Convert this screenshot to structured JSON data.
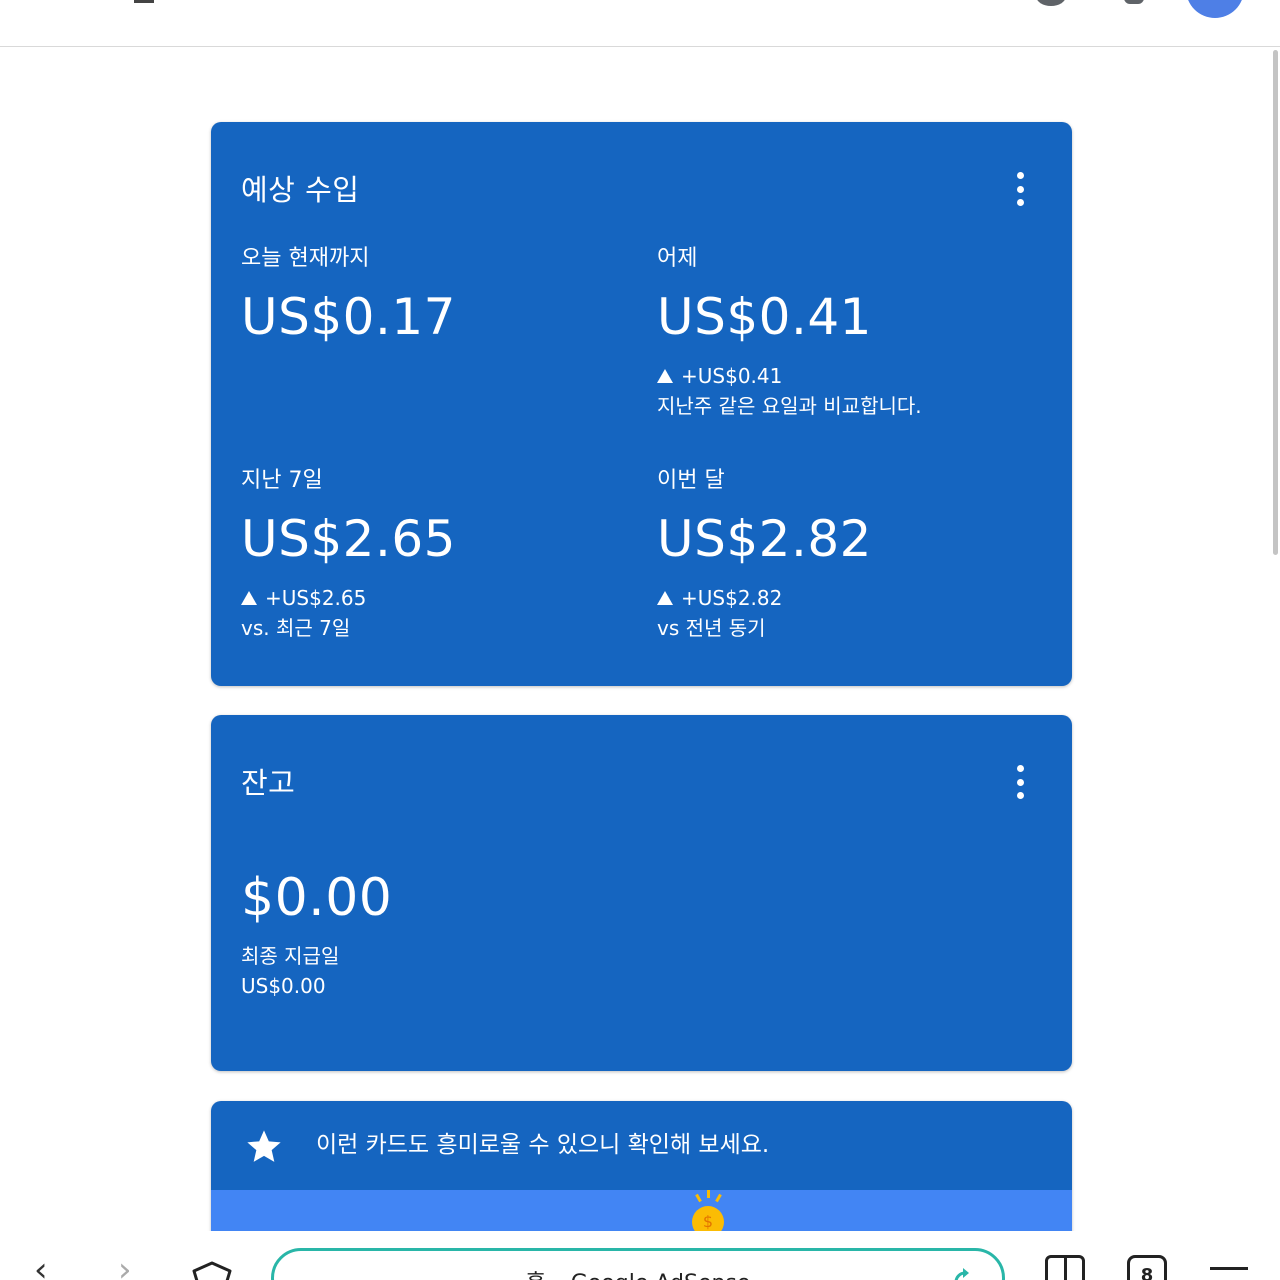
{
  "estimated": {
    "title": "예상 수입",
    "today": {
      "label": "오늘 현재까지",
      "value": "US$0.17"
    },
    "yesterday": {
      "label": "어제",
      "value": "US$0.41",
      "delta": "+US$0.41",
      "compare": "지난주 같은 요일과 비교합니다."
    },
    "last7": {
      "label": "지난 7일",
      "value": "US$2.65",
      "delta": "+US$2.65",
      "compare": "vs. 최근 7일"
    },
    "month": {
      "label": "이번 달",
      "value": "US$2.82",
      "delta": "+US$2.82",
      "compare": "vs 전년 동기"
    }
  },
  "balance": {
    "title": "잔고",
    "value": "$0.00",
    "last_payment_label": "최종 지급일",
    "last_payment_value": "US$0.00"
  },
  "suggest": {
    "text": "이런 카드도 흥미로울 수 있으니 확인해 보세요.",
    "coin_symbol": "$"
  },
  "browser": {
    "url_title": "홈 – Google AdSense",
    "tab_count": "8",
    "url_border_color": "#29b6a8"
  },
  "colors": {
    "card_bg": "#1565c0",
    "illustration_bg": "#4285f4"
  },
  "icons": [
    "kebab-menu-icon",
    "star-icon",
    "back-icon",
    "forward-icon",
    "home-icon",
    "reload-icon",
    "bookmarks-icon",
    "tabs-icon",
    "menu-icon"
  ]
}
